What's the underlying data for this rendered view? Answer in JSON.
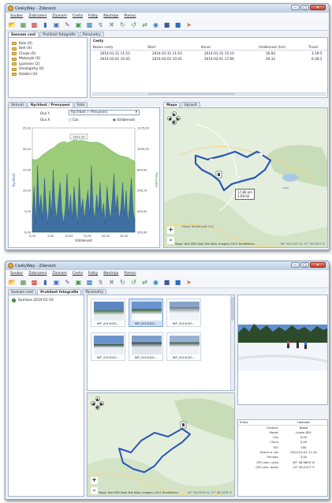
{
  "window_title": "CeskyWay - Zdeneck",
  "menu": [
    "Soubor",
    "Zobrazeni",
    "Zaznam",
    "Cesta",
    "Fotky",
    "Nastroje",
    "Pomoc"
  ],
  "tabs": [
    "Seznam cest",
    "Prohlizet fotografie",
    "Parametry"
  ],
  "categories": [
    {
      "label": "Kolo (0)"
    },
    {
      "label": "Beh (0)"
    },
    {
      "label": "Chuze (0)"
    },
    {
      "label": "Motocykl (0)"
    },
    {
      "label": "Lyzovani (2)"
    },
    {
      "label": "Geologicky (0)"
    },
    {
      "label": "Ostatni (0)"
    }
  ],
  "trips": {
    "title": "Cesty",
    "columns": [
      "Nazev cesty",
      "Start",
      "Konec",
      "Vzdalenost (km)",
      "Trvani"
    ],
    "rows": [
      [
        "2014-01-31 11:53",
        "2014-01-31 11:53",
        "2014-01-31 15:10",
        "16.04",
        "3:19:5"
      ],
      [
        "2014-02-01 10:45",
        "2014-02-01 10:45",
        "2014-02-01 17:06",
        "29.32",
        "6:28:2"
      ]
    ]
  },
  "analysis_tabs": [
    "Shrnuti",
    "Rychlost / Prevyseni",
    "Foto"
  ],
  "map_tabs": [
    "Mapa",
    "Upravit"
  ],
  "chart": {
    "axis1_label": "Osa Y",
    "axis1_value": "Rychlost + Prevyseni",
    "axis2_label": "Osa X",
    "axis2_opt1": "Cas",
    "axis2_opt2": "Vzdalenost",
    "tooltip": "1022.20"
  },
  "chart_data": {
    "type": "area",
    "xlabel": "Vzdalenost",
    "ylabel": "Rychlost",
    "y2label": "Prevyseni",
    "xticks": [
      "0,00",
      "5,00",
      "10,00",
      "15,00",
      "20,00",
      "25,00"
    ],
    "yticks_left": [
      "25,00",
      "20,00",
      "15,00",
      "10,00",
      "5,00",
      "0,00"
    ],
    "yticks_right": [
      "1275,00",
      "1000,00",
      "800,00",
      "596,72",
      "400,00",
      "200,00"
    ],
    "xlim": [
      0,
      28
    ],
    "ylim_left": [
      0,
      25
    ],
    "series": [
      {
        "name": "Rychlost",
        "values": [
          4,
          11,
          2,
          16,
          5,
          9,
          3,
          13,
          6,
          2,
          10,
          4,
          15,
          7,
          3,
          8,
          12,
          5,
          2,
          6,
          14,
          4,
          9,
          3,
          11,
          6,
          2,
          13,
          5,
          8,
          3,
          7,
          10,
          4,
          16,
          6,
          3,
          9,
          5,
          12,
          4,
          7,
          2,
          11,
          6,
          3,
          8,
          14,
          5,
          9,
          3,
          6,
          12,
          4,
          10,
          2,
          7,
          13,
          5,
          3
        ]
      },
      {
        "name": "Prevyseni",
        "values": [
          17.5,
          17.3,
          17.8,
          18.6,
          19.2,
          19.8,
          20.2,
          21,
          21.5,
          21.7,
          21.4,
          21.8,
          22.1,
          21.9,
          22,
          21.8,
          21.6,
          21.5,
          21.6,
          21.4,
          21,
          20.4,
          19.8,
          19.2,
          18.7,
          18.3,
          18.1,
          17.9,
          17.4,
          17
        ]
      }
    ]
  },
  "map": {
    "labels": [
      "17,86 km",
      "3:00:02"
    ],
    "attribution": "Mapa: Veel ZNX Data Tele Atlas, Imagery 2014 TerraMetrics",
    "coord1": "49° 56.2722' N, 17° 39.4377' E",
    "coord2": "49° 56.2314' N, 17° 38.2478' E",
    "town": "Oblast Nomelyadt (Ce)",
    "lake": "Lazy"
  },
  "album": {
    "label": "Sumava 2014-01-16"
  },
  "photos": [
    {
      "caption": "WP_2014020..."
    },
    {
      "caption": "WP_2014020..."
    },
    {
      "caption": "WP_2014020..."
    },
    {
      "caption": "WP_2014020..."
    },
    {
      "caption": "WP_2014020..."
    },
    {
      "caption": "WP_2014020..."
    }
  ],
  "props": {
    "header": [
      "Stitek",
      "Hodnota"
    ],
    "rows": [
      [
        "Vyrobce",
        "Nokia"
      ],
      [
        "Model",
        "Lumia 820"
      ],
      [
        "Cas",
        "0,00"
      ],
      [
        "Clona",
        "2,00"
      ],
      [
        "ISO",
        "100"
      ],
      [
        "Datum a cas",
        "2014-02-01 11:14"
      ],
      [
        "Ohnisko",
        "3,00"
      ],
      [
        "GPS zem. sirka",
        "49° 58.9829' N"
      ],
      [
        "GPS zem. delka",
        "13° 26.2127' E"
      ]
    ]
  },
  "colors": {
    "titlebar": "#c7d6ea",
    "accent": "#3b78c3",
    "speed": "#2f5fa8",
    "elevation": "#9ccc7a",
    "route": "#2a55b9"
  }
}
